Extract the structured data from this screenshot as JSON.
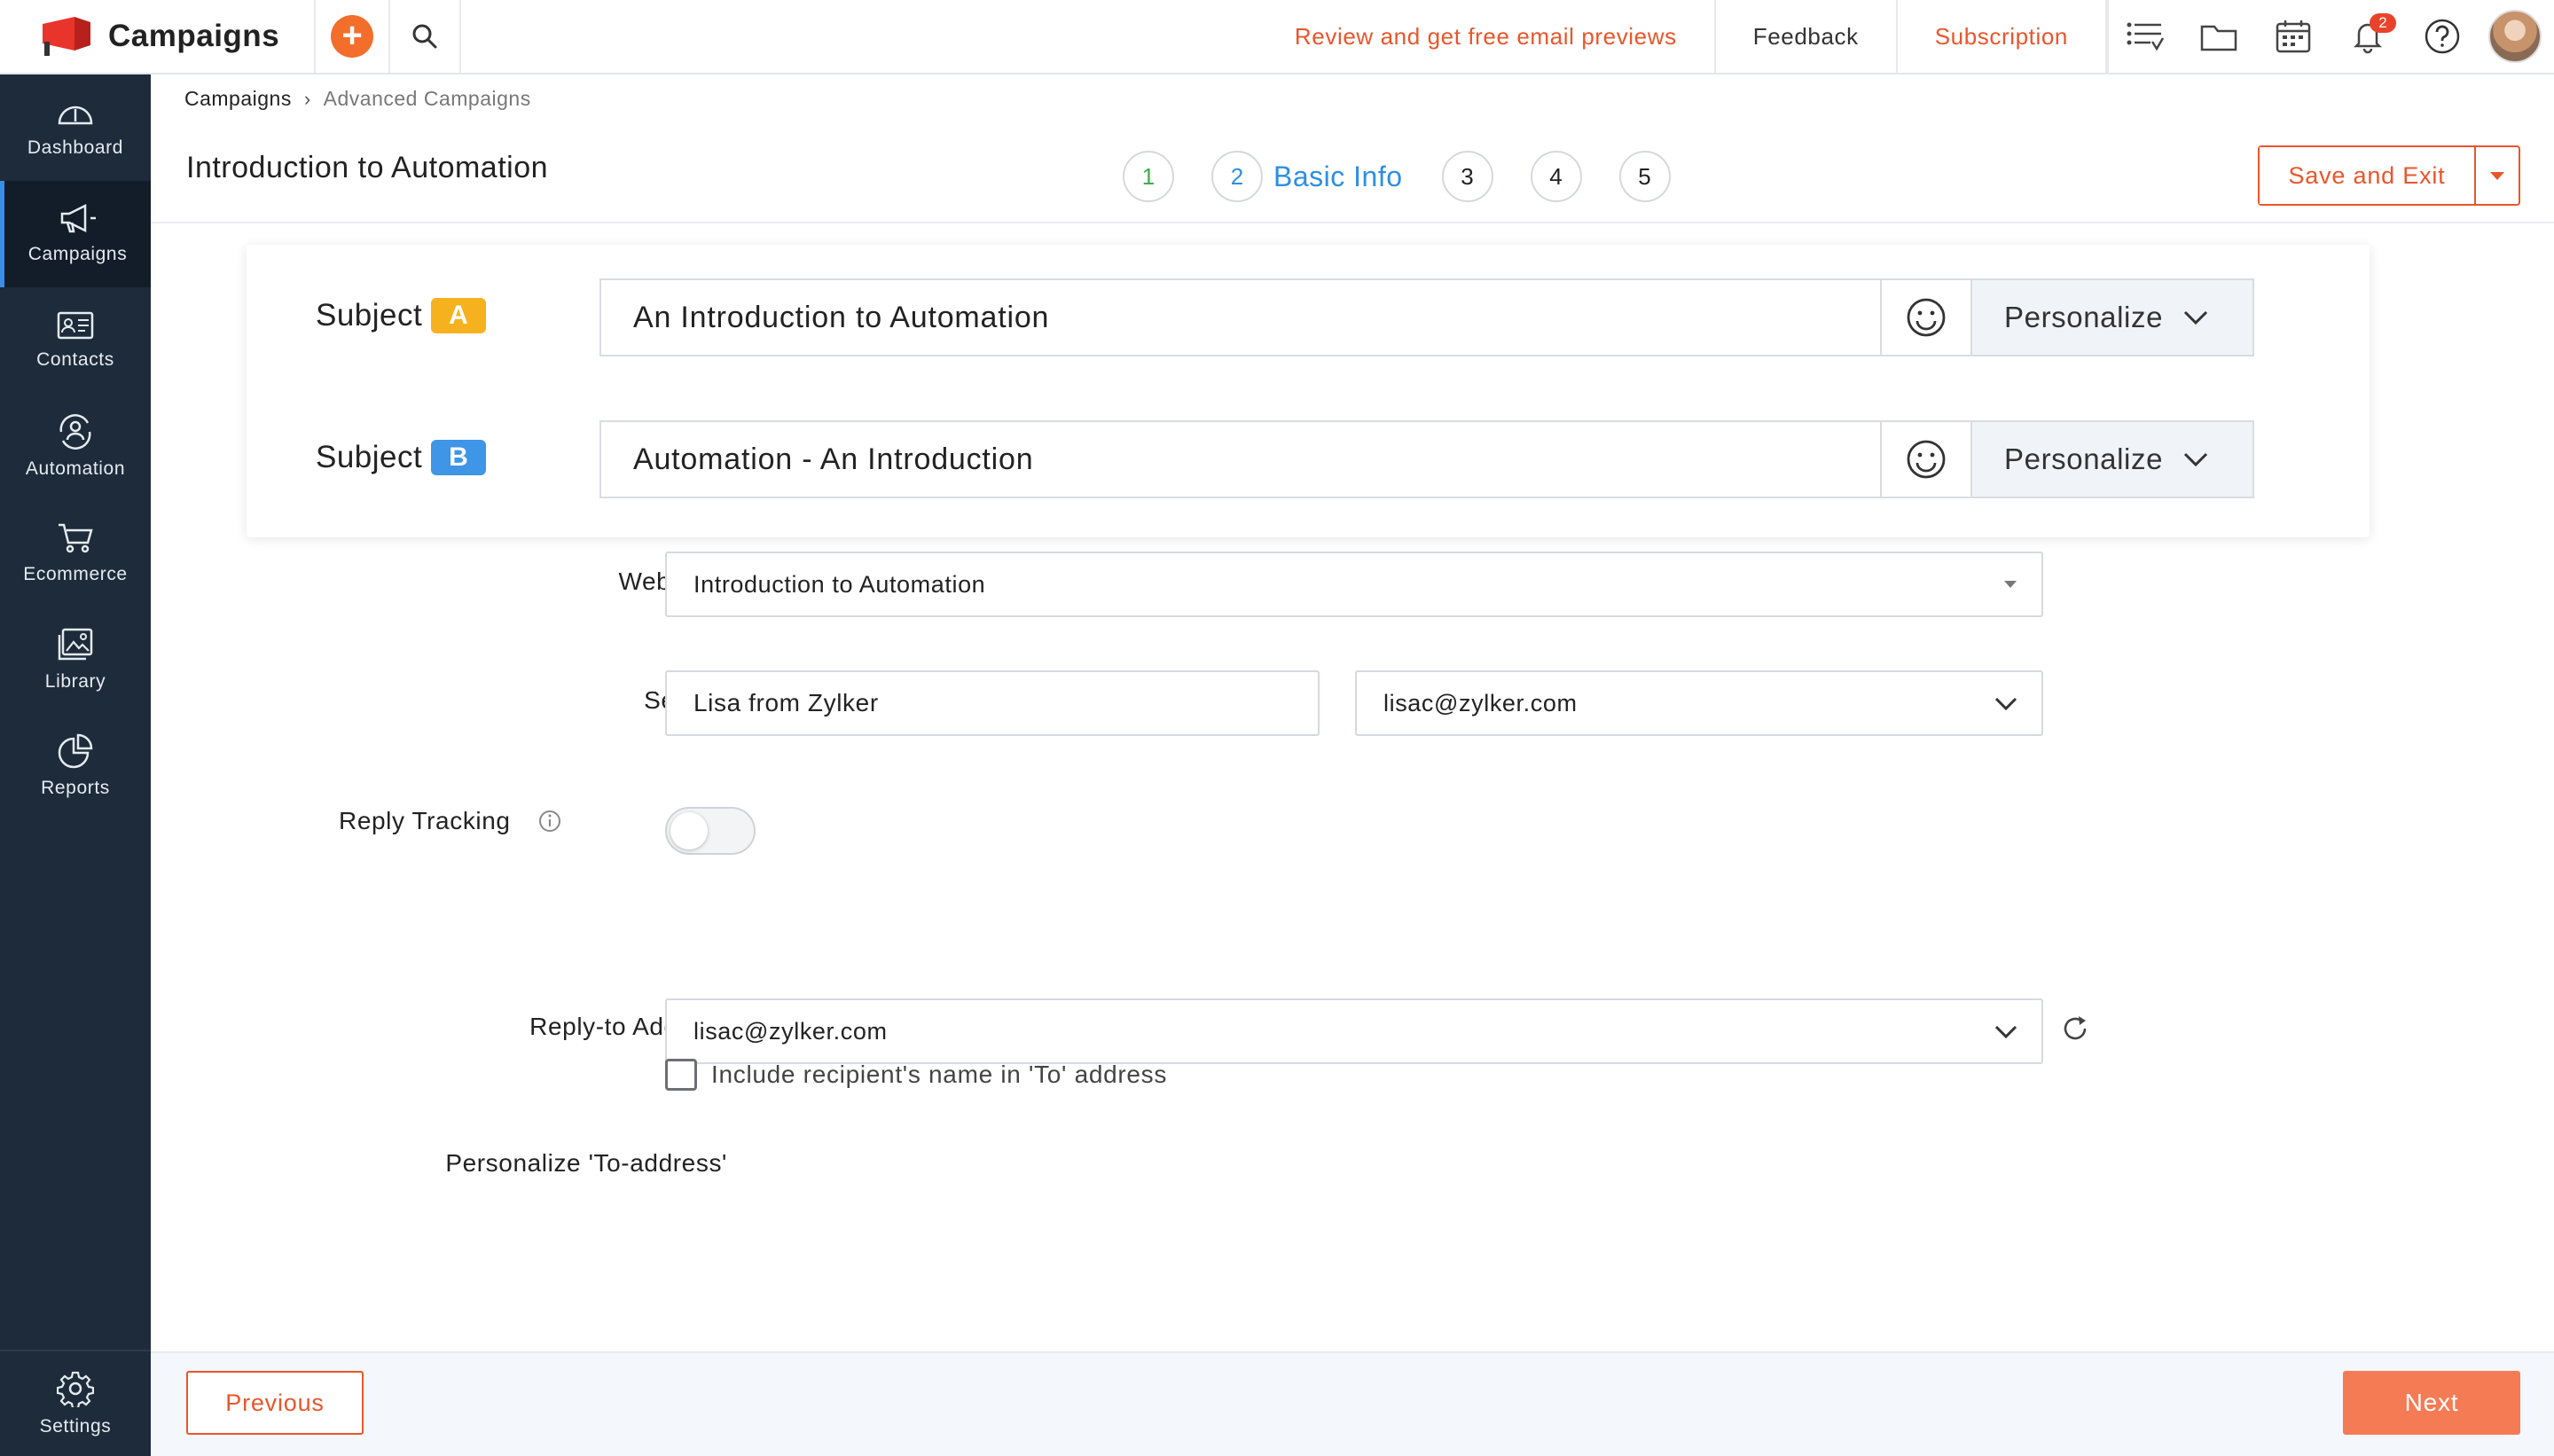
{
  "app": {
    "name": "Campaigns",
    "logo_icon": "campaigns-flag-logo",
    "accent_color": "#f36e2b",
    "sidebar_color": "#1d2b3a"
  },
  "topbar": {
    "review_link": "Review and get free email previews",
    "feedback": "Feedback",
    "subscription": "Subscription",
    "notification_count": "2"
  },
  "sidebar": {
    "items": [
      {
        "label": "Dashboard",
        "icon": "dashboard-icon"
      },
      {
        "label": "Campaigns",
        "icon": "megaphone-icon",
        "active": true
      },
      {
        "label": "Contacts",
        "icon": "contact-card-icon"
      },
      {
        "label": "Automation",
        "icon": "automation-icon"
      },
      {
        "label": "Ecommerce",
        "icon": "cart-icon"
      },
      {
        "label": "Library",
        "icon": "image-library-icon"
      },
      {
        "label": "Reports",
        "icon": "pie-chart-icon"
      }
    ],
    "settings": "Settings"
  },
  "breadcrumb": {
    "root": "Campaigns",
    "separator": "›",
    "current": "Advanced Campaigns"
  },
  "page": {
    "title": "Introduction to Automation",
    "steps": [
      "1",
      "2",
      "3",
      "4",
      "5"
    ],
    "current_step_label": "Basic Info",
    "save_exit": "Save and Exit"
  },
  "subjects": {
    "label": "Subject",
    "a": {
      "badge": "A",
      "value": "An Introduction to Automation"
    },
    "b": {
      "badge": "B",
      "value": "Automation - An Introduction"
    },
    "personalize": "Personalize"
  },
  "form": {
    "webinars_label": "Webinars",
    "webinars_value": "Introduction to Automation",
    "sender_label": "Sender",
    "sender_name": "Lisa from Zylker",
    "sender_email": "lisac@zylker.com",
    "reply_tracking_label": "Reply Tracking",
    "reply_tracking_on": false,
    "reply_to_label": "Reply-to Address",
    "reply_to_value": "lisac@zylker.com",
    "personalize_to_label": "Personalize 'To-address'",
    "include_name_label": "Include recipient's name in 'To' address",
    "include_name_checked": false
  },
  "footer": {
    "previous": "Previous",
    "next": "Next"
  }
}
